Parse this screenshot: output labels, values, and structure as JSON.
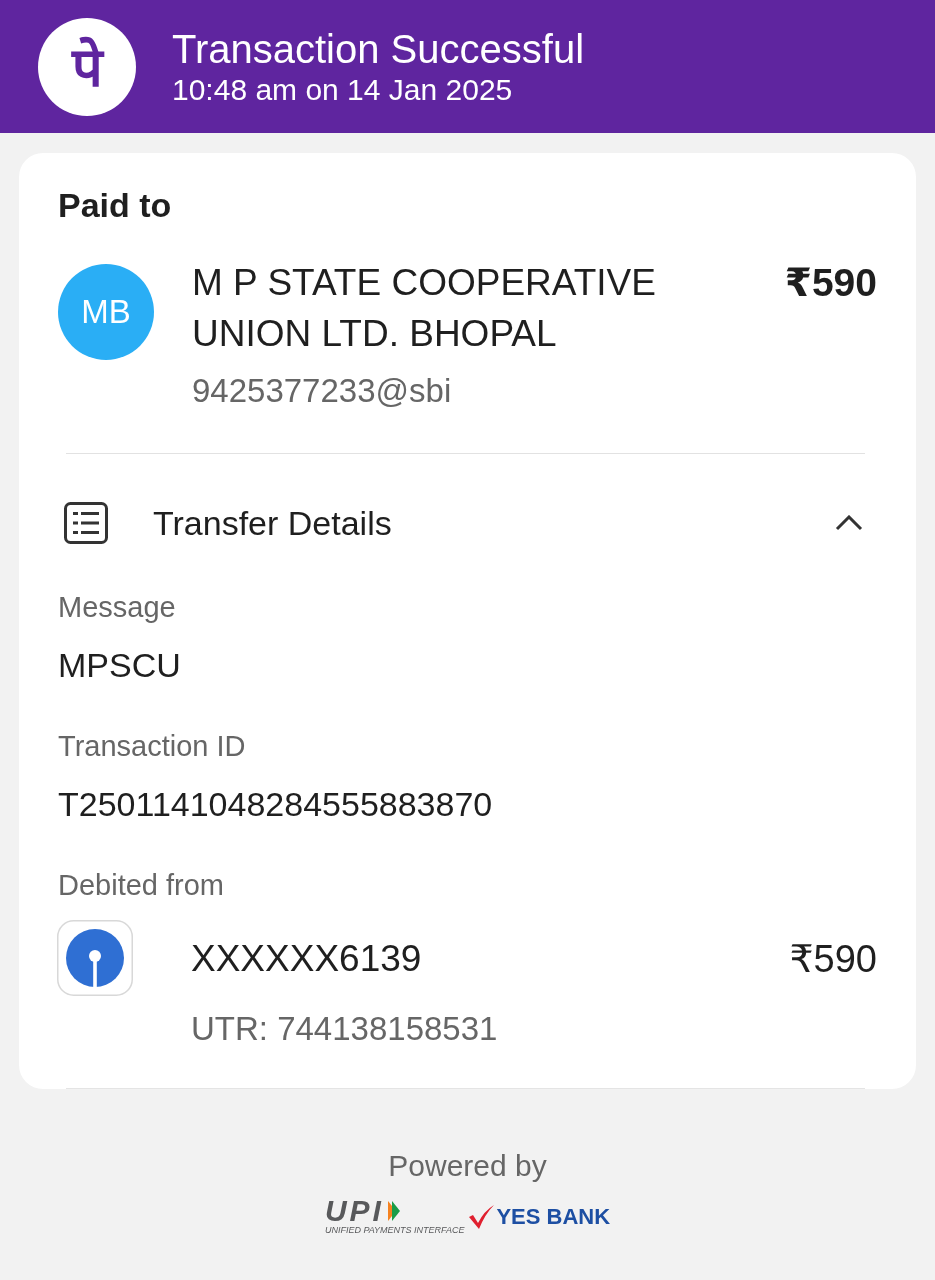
{
  "header": {
    "logo_text": "पे",
    "title": "Transaction Successful",
    "subtitle": "10:48 am on 14 Jan 2025"
  },
  "paid_to": {
    "heading": "Paid to",
    "avatar_initials": "MB",
    "name": "M P STATE COOPERATIVE UNION LTD. BHOPAL",
    "amount": "₹590",
    "vpa": "9425377233@sbi"
  },
  "transfer_details": {
    "title": "Transfer Details",
    "expanded": true,
    "fields": [
      {
        "label": "Message",
        "value": "MPSCU"
      },
      {
        "label": "Transaction ID",
        "value": "T2501141048284555883870"
      }
    ],
    "debit": {
      "label": "Debited from",
      "account": "XXXXXX6139",
      "amount": "₹590",
      "utr": "UTR: 744138158531"
    }
  },
  "footer": {
    "powered_by": "Powered by",
    "upi_logo": "UPI",
    "upi_tagline": "UNIFIED PAYMENTS INTERFACE",
    "bank_logo": "YES BANK"
  }
}
